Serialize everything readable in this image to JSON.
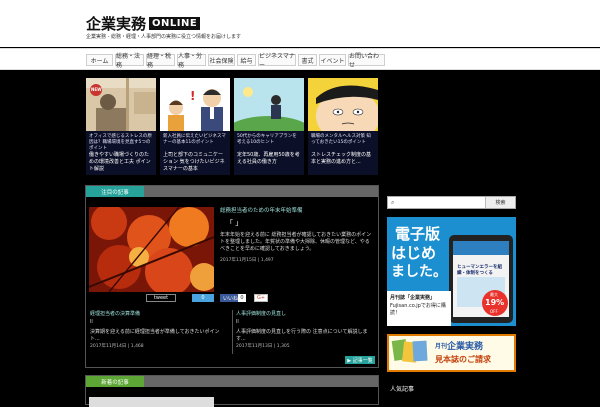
{
  "site": {
    "logo_text": "企業実務",
    "logo_badge": "ONLINE",
    "tagline": "企業実務 - 総務・経理・人事部門の実務に役立つ情報をお届けします"
  },
  "nav": [
    {
      "label": "ホーム"
    },
    {
      "label": "総務・法務"
    },
    {
      "label": "経理・税務"
    },
    {
      "label": "人事・労務"
    },
    {
      "label": "社会保険"
    },
    {
      "label": "給与"
    },
    {
      "label": "ビジネスマナー"
    },
    {
      "label": "書式"
    },
    {
      "label": "イベント"
    },
    {
      "label": "お問い合わせ"
    }
  ],
  "cards": [
    {
      "title": "オフィスで感じるストレスの原因は？職場環境を見直す5つのポイント",
      "subtitle": "働きやすい職場づくりのための環境改善と工夫 ポイント解説",
      "badge": "NEW"
    },
    {
      "title": "新入社員に伝えたいビジネスマナーの基本11のポイント",
      "subtitle": "上司と部下のコミュニケーション 気をつけたいビジネスマナーの基本"
    },
    {
      "title": "50代からのキャリアプランを考える10のヒント",
      "subtitle": "定年50歳、再雇用50歳を考える社員の働き方"
    },
    {
      "title": "職場のメンタルヘルス対策 知っておきたい15のポイント",
      "subtitle": "ストレスチェック制度の基本と実務の進め方と..."
    }
  ],
  "featured": {
    "tab": "注目の記事",
    "headline": "総務担当者のための年末年始準備",
    "subhead": "「 」",
    "body": "年末年始を迎える前に 総務担当者が確認しておきたい業務のポイントを整理しました。年賀状の準備や大掃除、休暇の管理など、やるべきことを早めに確認しておきましょう。",
    "meta": "2017年11月15日 | 1,497",
    "share": [
      {
        "label": "tweet",
        "count": "0"
      },
      {
        "label": "いいね！",
        "count": "0"
      },
      {
        "label": "G+",
        "count": ""
      }
    ],
    "sub_articles": [
      {
        "title": "経理担当者の決算準備",
        "mark": "ll",
        "body": "決算期を迎える前に経理担当者が準備しておきたいポイント...",
        "meta": "2017年11月14日 | 1,468"
      },
      {
        "title": "人事評価制度の見直し",
        "mark": "ll",
        "body": "人事評価制度の見直しを行う際の 注意点について解説します...",
        "meta": "2017年11月13日 | 1,305"
      }
    ],
    "more": "▶ 記事一覧"
  },
  "panel2": {
    "tab": "新着の記事"
  },
  "sidebar": {
    "search_placeholder": "",
    "search_button": "検索",
    "ad1": {
      "headline1": "電子版",
      "headline2": "はじめ",
      "headline3": "ました。",
      "magazine": "月刊誌「企業実務」",
      "source": "Fujisan.co.jpでお得に購読！",
      "discount_top": "最大",
      "discount": "19%",
      "discount_bottom": "OFF",
      "book_title": "ヒューマンエラーを組織・体制をつくる"
    },
    "ad2": {
      "line1": "月刊",
      "line1b": "企業実務",
      "line2": "見本誌のご請求"
    },
    "section_heading": "人気記事"
  },
  "colors": {
    "teal_accent": "#26a29a",
    "green_accent": "#5da636",
    "ad_blue": "#1c8fd0",
    "ad_orange": "#e07b00"
  }
}
